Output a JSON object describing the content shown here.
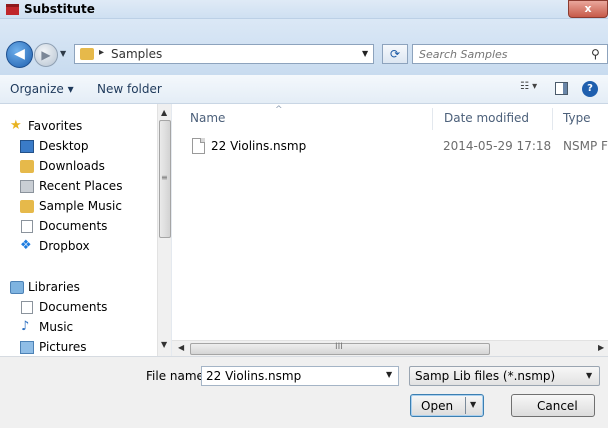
{
  "window": {
    "title": "Substitute",
    "close_label": "x"
  },
  "address_bar": {
    "back_icon": "back-arrow-icon",
    "forward_icon": "forward-arrow-icon",
    "crumb_separator": "▸",
    "breadcrumb": "Samples",
    "refresh_icon": "refresh-icon",
    "search_placeholder": "Search Samples"
  },
  "toolbar": {
    "organize_label": "Organize ▾",
    "new_folder_label": "New folder",
    "views_icon": "views-icon",
    "help_label": "?"
  },
  "nav_pane": {
    "favorites_header": "Favorites",
    "favorites": [
      {
        "label": "Desktop",
        "icon": "desktop-icon"
      },
      {
        "label": "Downloads",
        "icon": "downloads-icon"
      },
      {
        "label": "Recent Places",
        "icon": "recent-places-icon"
      },
      {
        "label": "Sample Music",
        "icon": "folder-icon"
      },
      {
        "label": "Documents",
        "icon": "documents-icon"
      },
      {
        "label": "Dropbox",
        "icon": "dropbox-icon"
      }
    ],
    "libraries_header": "Libraries",
    "libraries": [
      {
        "label": "Documents",
        "icon": "documents-icon"
      },
      {
        "label": "Music",
        "icon": "music-icon"
      },
      {
        "label": "Pictures",
        "icon": "pictures-icon"
      }
    ]
  },
  "file_list": {
    "columns": {
      "name": "Name",
      "date_modified": "Date modified",
      "type": "Type"
    },
    "sort_indicator": "^",
    "rows": [
      {
        "name": "22 Violins.nsmp",
        "date_modified": "2014-05-29 17:18",
        "type": "NSMP File"
      }
    ],
    "h_scroll_grip": "III"
  },
  "footer": {
    "file_name_label": "File name:",
    "file_name_value": "22 Violins.nsmp",
    "file_type_value": "Samp Lib files (*.nsmp)",
    "open_label": "Open",
    "cancel_label": "Cancel"
  },
  "colors": {
    "accent": "#1f5fae",
    "title_icon": "#c0262b",
    "column_header": "#4c607a"
  }
}
